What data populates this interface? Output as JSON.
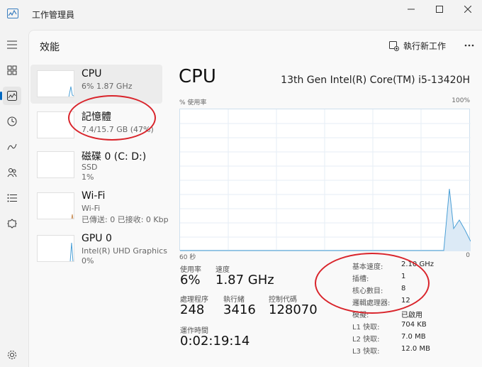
{
  "window": {
    "title": "工作管理員"
  },
  "rail": {
    "items": [
      "menu-icon",
      "processes-icon",
      "performance-icon",
      "history-icon",
      "startup-icon",
      "users-icon",
      "details-icon",
      "services-icon",
      "settings-icon"
    ],
    "active": "performance-icon"
  },
  "header": {
    "title": "效能",
    "run_task": "執行新工作"
  },
  "resources": [
    {
      "name": "CPU",
      "sub1": "6% 1.87 GHz",
      "sub2": "",
      "selected": true
    },
    {
      "name": "記憶體",
      "sub1": "7.4/15.7 GB (47%)",
      "sub2": ""
    },
    {
      "name": "磁碟 0 (C: D:)",
      "sub1": "SSD",
      "sub2": "1%"
    },
    {
      "name": "Wi-Fi",
      "sub1": "Wi-Fi",
      "sub2": "已傳送: 0 已接收: 0 Kbp"
    },
    {
      "name": "GPU 0",
      "sub1": "Intel(R) UHD Graphics",
      "sub2": "0%"
    }
  ],
  "detail": {
    "title": "CPU",
    "model": "13th Gen Intel(R) Core(TM) i5-13420H",
    "chart_ylabel": "% 使用率",
    "chart_ymax": "100%",
    "chart_xleft": "60 秒",
    "chart_xright": "0",
    "usage_label": "使用率",
    "usage_value": "6%",
    "speed_label": "速度",
    "speed_value": "1.87 GHz",
    "processes_label": "處理程序",
    "processes_value": "248",
    "threads_label": "執行緒",
    "threads_value": "3416",
    "handles_label": "控制代碼",
    "handles_value": "128070",
    "uptime_label": "運作時間",
    "uptime_value": "0:02:19:14",
    "specs": [
      {
        "k": "基本速度:",
        "v": "2.10 GHz"
      },
      {
        "k": "插槽:",
        "v": "1"
      },
      {
        "k": "核心數目:",
        "v": "8"
      },
      {
        "k": "邏輯處理器:",
        "v": "12"
      },
      {
        "k": "模擬:",
        "v": "已啟用"
      },
      {
        "k": "L1 快取:",
        "v": "704 KB"
      },
      {
        "k": "L2 快取:",
        "v": "7.0 MB"
      },
      {
        "k": "L3 快取:",
        "v": "12.0 MB"
      }
    ]
  },
  "colors": {
    "accent": "#0067c0",
    "cpu_line": "#4a9fd6",
    "annotation": "#d9242b"
  }
}
